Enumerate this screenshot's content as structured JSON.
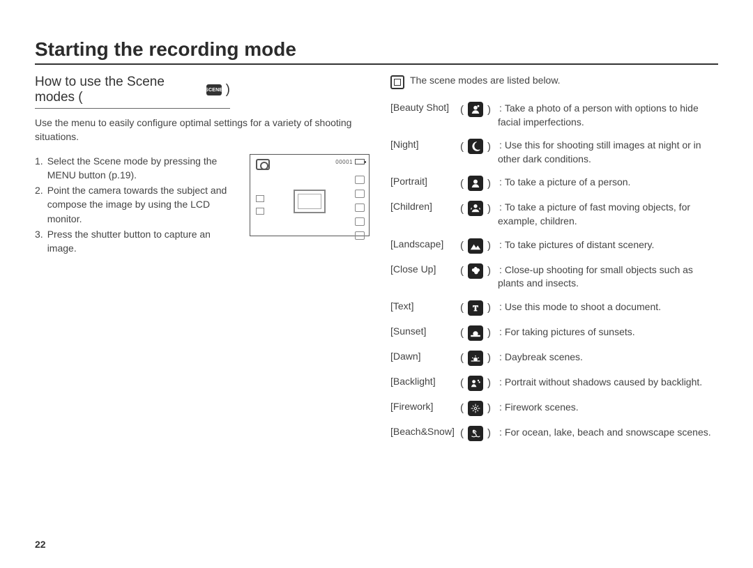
{
  "page": {
    "title": "Starting the recording mode",
    "number": "22"
  },
  "left": {
    "subhead": "How to use the Scene modes (",
    "subhead_close": ")",
    "scene_badge": "SCENE",
    "intro": "Use the menu to easily configure optimal settings for a variety of shooting situations.",
    "steps": [
      {
        "num": "1.",
        "text": "Select the Scene mode by pressing the MENU button (p.19)."
      },
      {
        "num": "2.",
        "text": "Point the camera towards the subject and compose the image by using the LCD monitor."
      },
      {
        "num": "3.",
        "text": "Press the shutter button to capture an image."
      }
    ],
    "lcd_counter": "00001"
  },
  "right": {
    "intro": "The scene modes are listed below.",
    "scenes": [
      {
        "label": "[Beauty Shot]",
        "icon": "beauty",
        "desc": "Take a photo of a person with options to hide facial imperfections."
      },
      {
        "label": "[Night]",
        "icon": "night",
        "desc": "Use this for shooting still images at night or in other dark conditions."
      },
      {
        "label": "[Portrait]",
        "icon": "portrait",
        "desc": "To take a picture of a person."
      },
      {
        "label": "[Children]",
        "icon": "children",
        "desc": "To take a picture of fast moving objects, for example, children."
      },
      {
        "label": "[Landscape]",
        "icon": "landscape",
        "desc": "To take pictures of distant scenery."
      },
      {
        "label": "[Close Up]",
        "icon": "closeup",
        "desc": "Close-up shooting for small objects such as plants and insects."
      },
      {
        "label": "[Text]",
        "icon": "text",
        "desc": "Use this mode to shoot a document."
      },
      {
        "label": "[Sunset]",
        "icon": "sunset",
        "desc": "For taking pictures of sunsets."
      },
      {
        "label": "[Dawn]",
        "icon": "dawn",
        "desc": "Daybreak scenes."
      },
      {
        "label": "[Backlight]",
        "icon": "backlight",
        "desc": "Portrait without shadows caused by backlight."
      },
      {
        "label": "[Firework]",
        "icon": "firework",
        "desc": "Firework scenes."
      },
      {
        "label": "[Beach&Snow]",
        "icon": "beachsnow",
        "desc": "For ocean, lake, beach and snowscape scenes."
      }
    ]
  }
}
